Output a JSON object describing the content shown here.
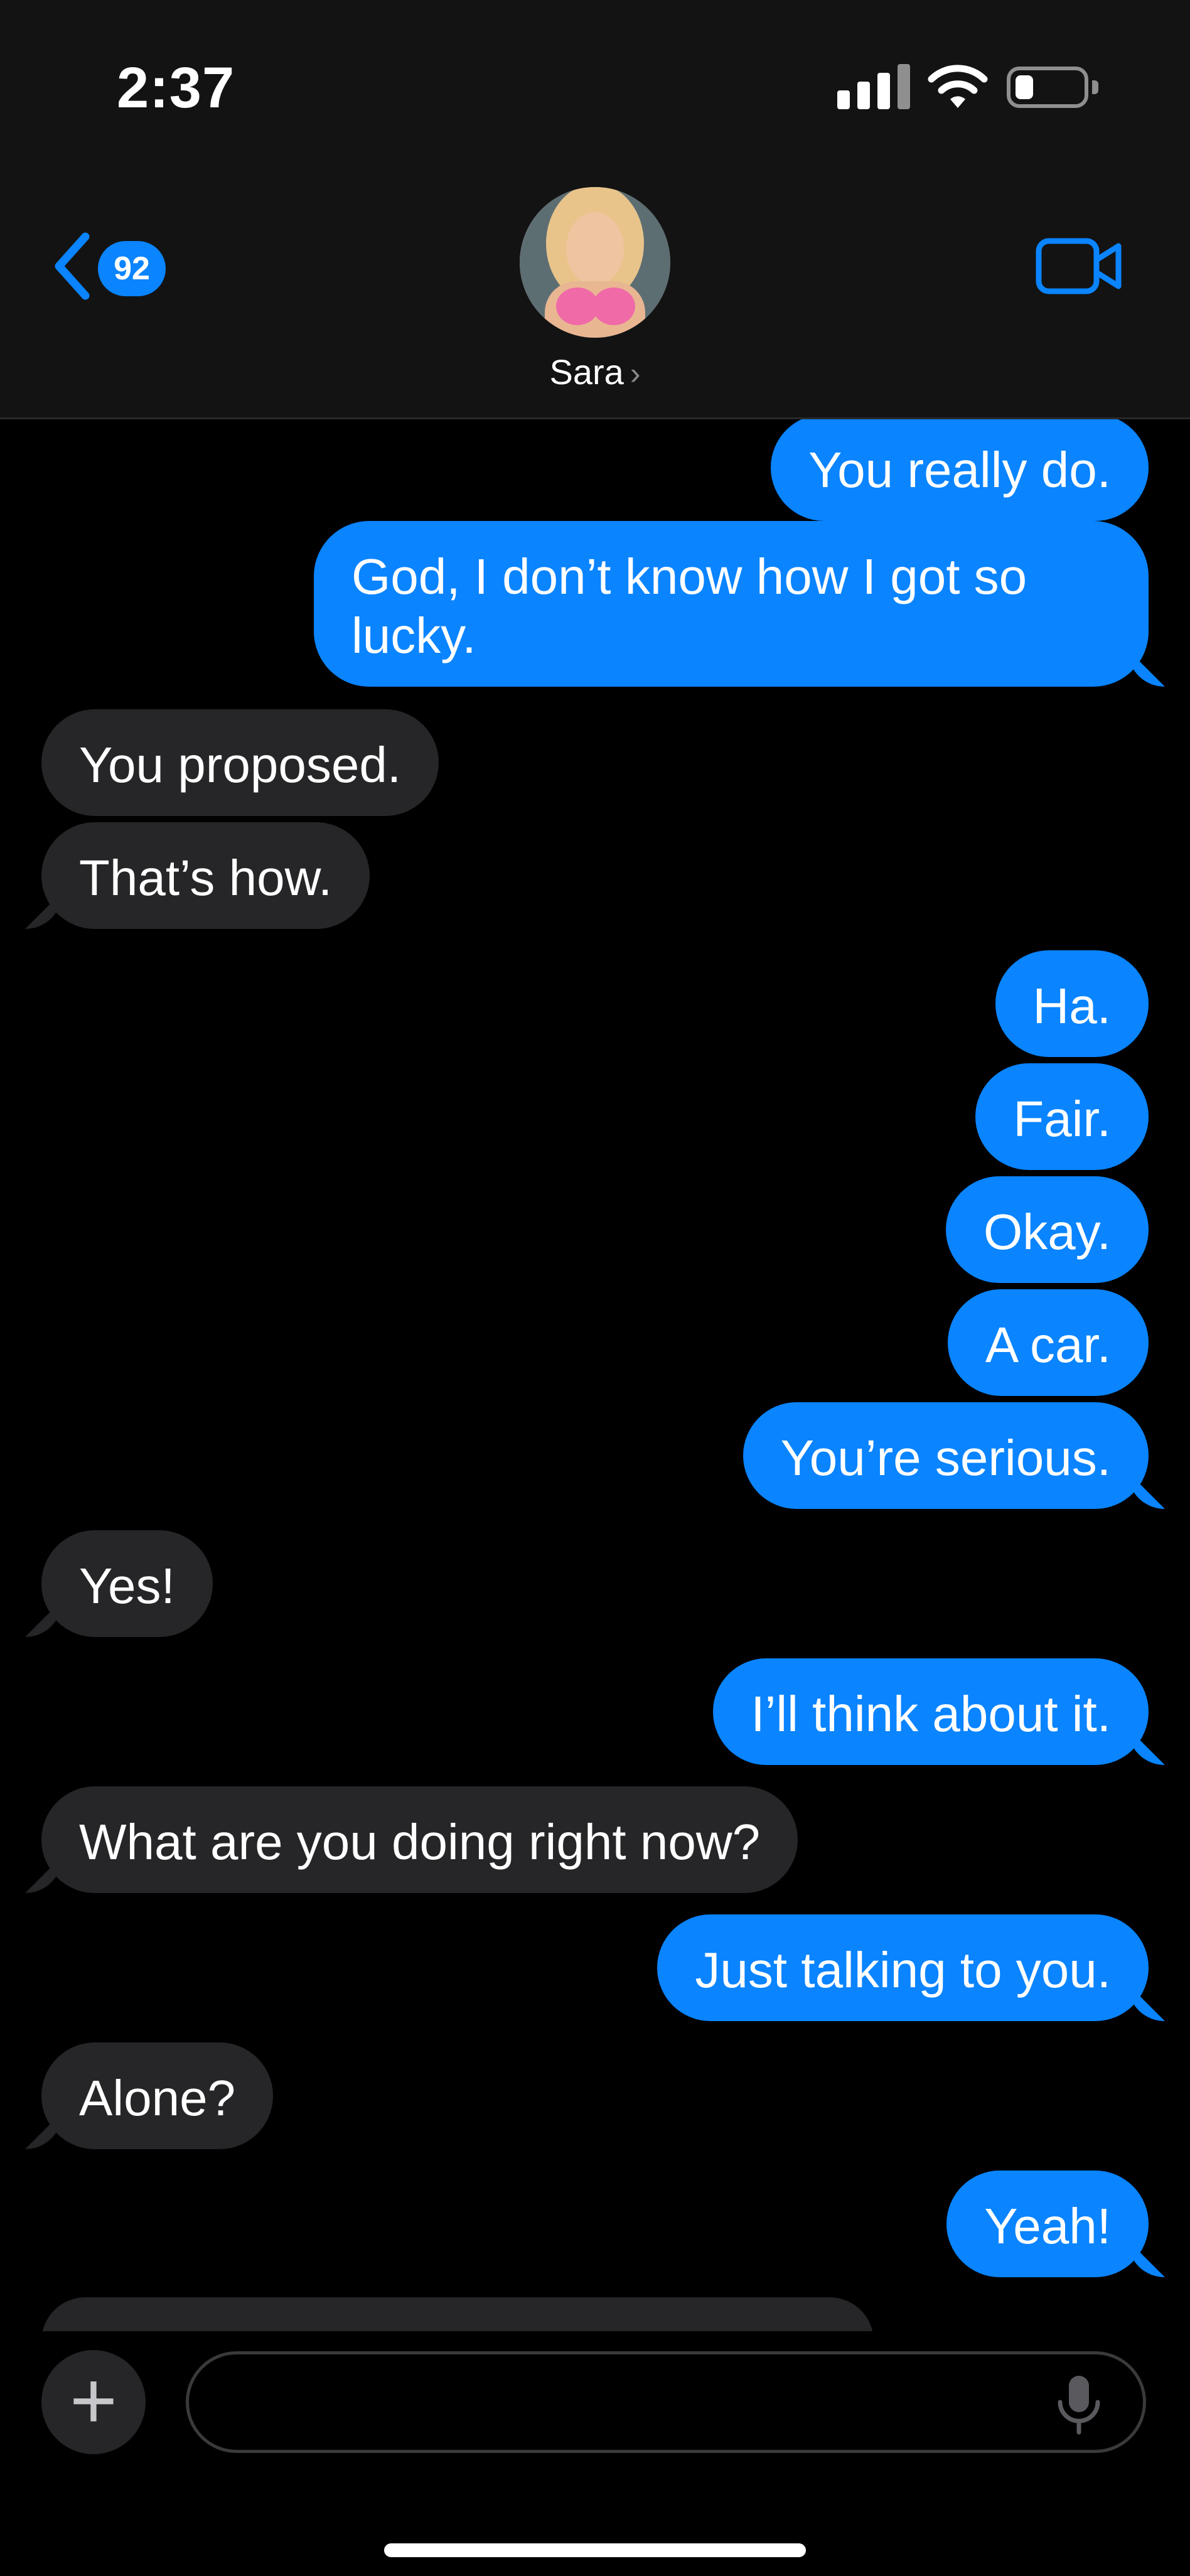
{
  "status_bar": {
    "time": "2:37"
  },
  "header": {
    "back_badge": "92",
    "contact_name": "Sara",
    "name_chevron": "›"
  },
  "icons": {
    "back": "chevron-left-icon",
    "video": "video-camera-icon",
    "plus": "plus-icon",
    "mic": "microphone-icon"
  },
  "colors": {
    "accent": "#0a84ff",
    "received_bubble": "#262628",
    "background": "#000000"
  },
  "messages": [
    {
      "side": "sent",
      "text": "You really do."
    },
    {
      "side": "sent",
      "text": "God, I don’t know how I got so lucky."
    },
    {
      "side": "received",
      "text": "You proposed."
    },
    {
      "side": "received",
      "text": "That’s how."
    },
    {
      "side": "sent",
      "text": "Ha."
    },
    {
      "side": "sent",
      "text": "Fair."
    },
    {
      "side": "sent",
      "text": "Okay."
    },
    {
      "side": "sent",
      "text": "A car."
    },
    {
      "side": "sent",
      "text": "You’re serious."
    },
    {
      "side": "received",
      "text": "Yes!"
    },
    {
      "side": "sent",
      "text": "I’ll think about it."
    },
    {
      "side": "received",
      "text": "What are you doing right now?"
    },
    {
      "side": "sent",
      "text": "Just talking to you."
    },
    {
      "side": "received",
      "text": "Alone?"
    },
    {
      "side": "sent",
      "text": "Yeah!"
    }
  ],
  "composer": {
    "plus_label": "+",
    "input_value": ""
  }
}
